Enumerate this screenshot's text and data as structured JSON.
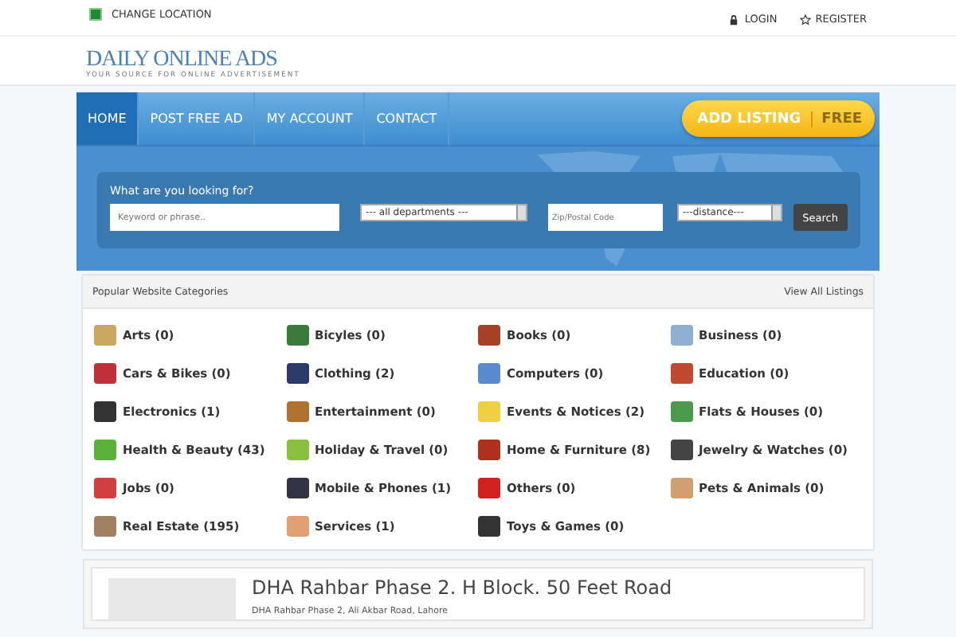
{
  "top_bar": {
    "location_link": "CHANGE LOCATION",
    "links": [
      {
        "label": "LOGIN",
        "kind": "lock"
      },
      {
        "label": "REGISTER",
        "kind": "star"
      }
    ]
  },
  "header": {
    "logo": "DAILY ONLINE ADS",
    "tagline": "YOUR SOURCE FOR ONLINE ADVERTISEMENT"
  },
  "nav": {
    "items": [
      {
        "label": "HOME",
        "selected": true
      },
      {
        "label": "POST FREE AD",
        "selected": false
      },
      {
        "label": "MY ACCOUNT",
        "selected": false
      },
      {
        "label": "CONTACT",
        "selected": false
      }
    ],
    "cta": {
      "label": "ADD LISTING",
      "badge": "FREE"
    }
  },
  "search": {
    "heading": "What are you looking for?",
    "keyword": {
      "placeholder": "Keyword or phrase.."
    },
    "department": {
      "value": "--- all departments ---"
    },
    "zip": {
      "placeholder": "Zip/Postal Code"
    },
    "distance": {
      "value": "---distance---"
    },
    "button": "Search"
  },
  "categories": {
    "title": "Popular Website Categories",
    "view_all": "View All Listings",
    "items": [
      {
        "label": "Arts (0)"
      },
      {
        "label": "Bicyles (0)"
      },
      {
        "label": "Books (0)"
      },
      {
        "label": "Business (0)"
      },
      {
        "label": "Cars & Bikes (0)"
      },
      {
        "label": "Clothing (2)"
      },
      {
        "label": "Computers (0)"
      },
      {
        "label": "Education (0)"
      },
      {
        "label": "Electronics (1)"
      },
      {
        "label": "Entertainment (0)"
      },
      {
        "label": "Events & Notices (2)"
      },
      {
        "label": "Flats & Houses (0)"
      },
      {
        "label": "Health & Beauty (43)"
      },
      {
        "label": "Holiday & Travel (0)"
      },
      {
        "label": "Home & Furniture (8)"
      },
      {
        "label": "Jewelry & Watches (0)"
      },
      {
        "label": "Jobs (0)"
      },
      {
        "label": "Mobile & Phones (1)"
      },
      {
        "label": "Others (0)"
      },
      {
        "label": "Pets & Animals (0)"
      },
      {
        "label": "Real Estate (195)"
      },
      {
        "label": "Services (1)"
      },
      {
        "label": "Toys & Games (0)"
      }
    ]
  },
  "listing": {
    "title": "DHA Rahbar Phase 2. H Block. 50 Feet Road",
    "address": "DHA Rahbar Phase 2, Ali Akbar Road, Lahore"
  }
}
